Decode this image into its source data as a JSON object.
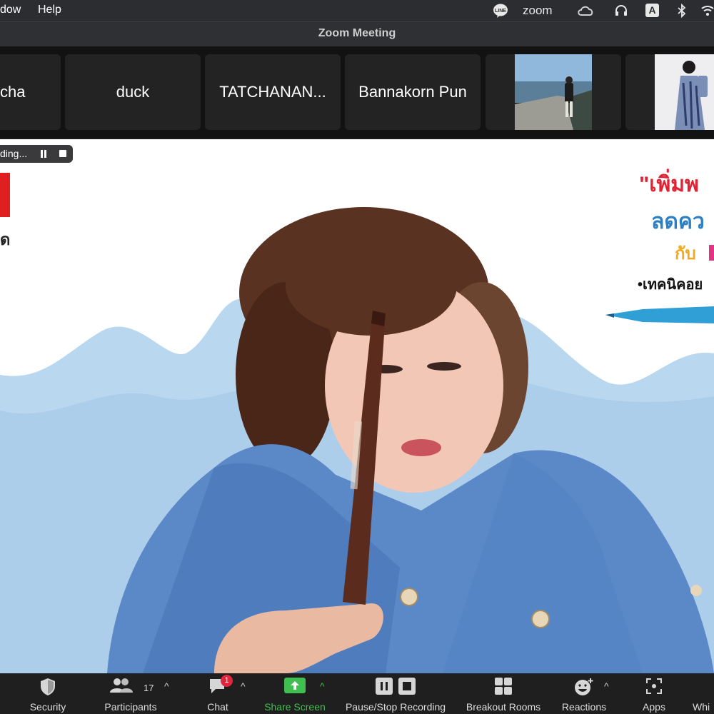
{
  "menubar": {
    "items": [
      "dow",
      "Help"
    ],
    "line_label": "LINE",
    "zoom_label": "zoom",
    "input_label": "A"
  },
  "window": {
    "title": "Zoom Meeting"
  },
  "thumbnails": [
    {
      "name": "cha"
    },
    {
      "name": "duck"
    },
    {
      "name": "TATCHANAN..."
    },
    {
      "name": "Bannakorn Pun"
    }
  ],
  "recording": {
    "label": "ding..."
  },
  "toolbar": {
    "security": "Security",
    "participants": "Participants",
    "participants_count": "17",
    "chat": "Chat",
    "chat_badge": "1",
    "share": "Share Screen",
    "record": "Pause/Stop Recording",
    "breakout": "Breakout Rooms",
    "reactions": "Reactions",
    "apps": "Apps",
    "whiteboard": "Whi"
  },
  "colors": {
    "share_green": "#3fbf4f",
    "badge_red": "#e0263a",
    "toolbar_bg": "#1f1f1f"
  }
}
